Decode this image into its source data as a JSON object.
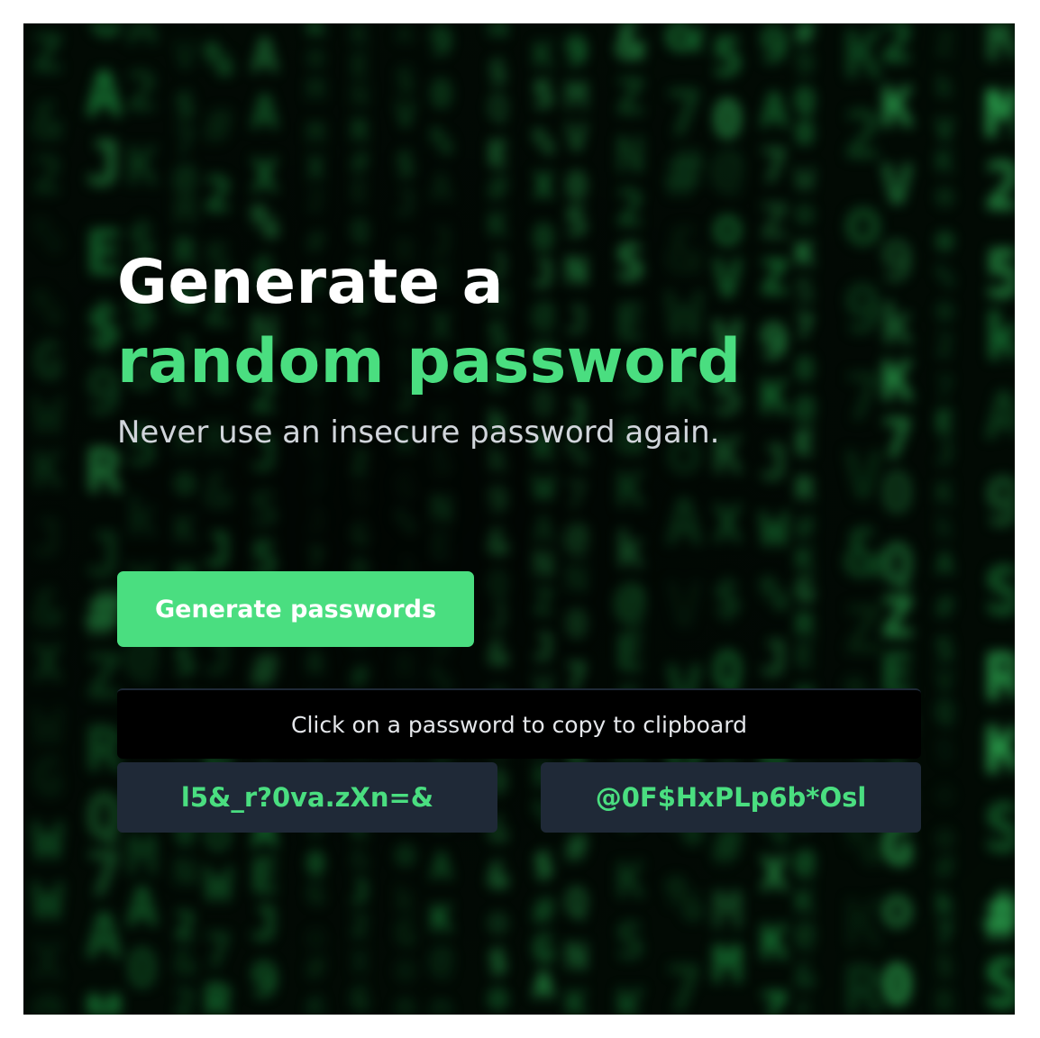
{
  "hero": {
    "title_line1": "Generate a",
    "title_line2": "random password",
    "subtitle": "Never use an insecure password again."
  },
  "actions": {
    "generate_label": "Generate passwords"
  },
  "results": {
    "hint": "Click on a password to copy to clipboard",
    "passwords": [
      "l5&_r?0va.zXn=&",
      "@0F$HxPLp6b*Osl"
    ]
  },
  "theme": {
    "accent": "#4ade80",
    "panel": "#1f2937",
    "background": "#020c05",
    "rain_colors": [
      "#0b3d1a",
      "#14692e",
      "#1f9a44",
      "#35c45e"
    ]
  }
}
